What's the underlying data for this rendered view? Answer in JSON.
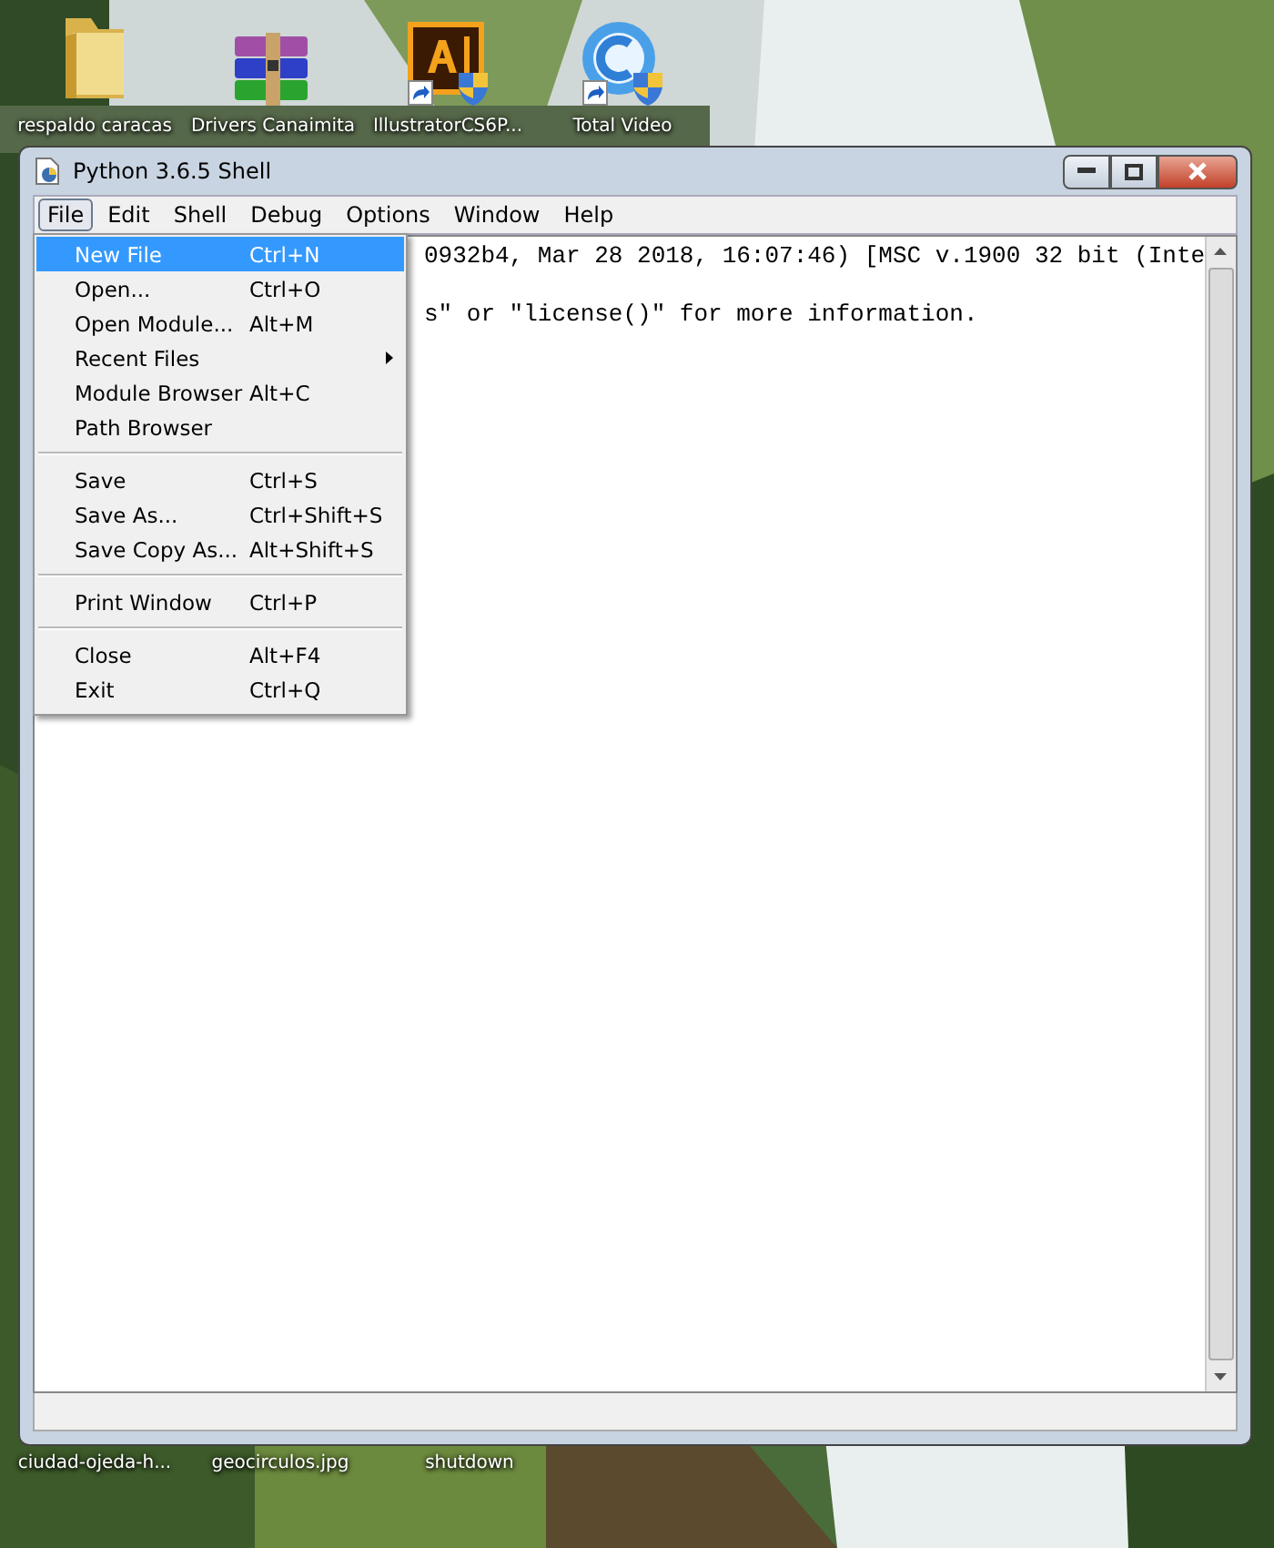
{
  "desktop_icons": [
    {
      "label": "respaldo caracas",
      "kind": "folder",
      "shortcut": false
    },
    {
      "label": "Drivers Canaimita",
      "kind": "archive",
      "shortcut": false
    },
    {
      "label": "IllustratorCS6P...",
      "kind": "illustrator",
      "shortcut": true
    },
    {
      "label": "Total Video",
      "kind": "video",
      "shortcut": true
    }
  ],
  "window": {
    "title": "Python 3.6.5 Shell",
    "menu_bar": [
      {
        "label": "File",
        "selected": true
      },
      {
        "label": "Edit",
        "selected": false
      },
      {
        "label": "Shell",
        "selected": false
      },
      {
        "label": "Debug",
        "selected": false
      },
      {
        "label": "Options",
        "selected": false
      },
      {
        "label": "Window",
        "selected": false
      },
      {
        "label": "Help",
        "selected": false
      }
    ],
    "shell_lines": [
      "0932b4, Mar 28 2018, 16:07:46) [MSC v.1900 32 bit (Inte",
      "s\" or \"license()\" for more information."
    ]
  },
  "file_menu": [
    {
      "kind": "item",
      "label": "New File",
      "shortcut": "Ctrl+N",
      "selected": true,
      "submenu": false
    },
    {
      "kind": "item",
      "label": "Open...",
      "shortcut": "Ctrl+O",
      "selected": false,
      "submenu": false
    },
    {
      "kind": "item",
      "label": "Open Module...",
      "shortcut": "Alt+M",
      "selected": false,
      "submenu": false
    },
    {
      "kind": "item",
      "label": "Recent Files",
      "selected": false,
      "submenu": true
    },
    {
      "kind": "item",
      "label": "Module Browser",
      "shortcut": "Alt+C",
      "selected": false,
      "submenu": false
    },
    {
      "kind": "item",
      "label": "Path Browser",
      "selected": false,
      "submenu": false
    },
    {
      "kind": "separator"
    },
    {
      "kind": "item",
      "label": "Save",
      "shortcut": "Ctrl+S",
      "selected": false,
      "submenu": false
    },
    {
      "kind": "item",
      "label": "Save As...",
      "shortcut": "Ctrl+Shift+S",
      "selected": false,
      "submenu": false
    },
    {
      "kind": "item",
      "label": "Save Copy As...",
      "shortcut": "Alt+Shift+S",
      "selected": false,
      "submenu": false
    },
    {
      "kind": "separator"
    },
    {
      "kind": "item",
      "label": "Print Window",
      "shortcut": "Ctrl+P",
      "selected": false,
      "submenu": false
    },
    {
      "kind": "separator"
    },
    {
      "kind": "item",
      "label": "Close",
      "shortcut": "Alt+F4",
      "selected": false,
      "submenu": false
    },
    {
      "kind": "item",
      "label": "Exit",
      "shortcut": "Ctrl+Q",
      "selected": false,
      "submenu": false
    }
  ],
  "desktop_labels_bottom": [
    "ciudad-ojeda-h...",
    "geocirculos.jpg",
    "shutdown"
  ]
}
